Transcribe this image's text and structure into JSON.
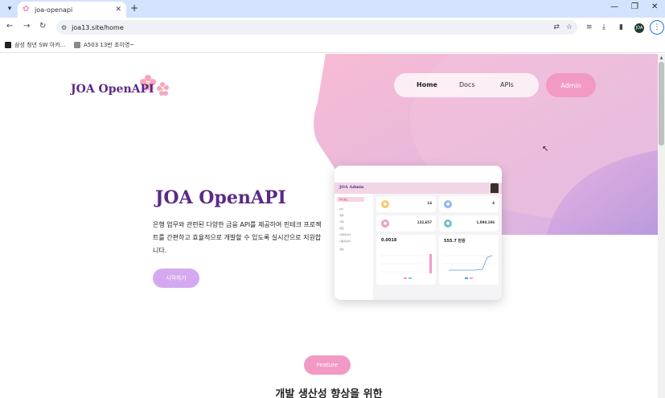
{
  "browser": {
    "tab_title": "joa-openapi",
    "tab_menu_icon": "chevron-down-icon",
    "new_tab": "+",
    "close_tab": "✕",
    "url": "joa13.site/home",
    "bookmarks": [
      "삼성 청년 SW 아카...",
      "A503 13반 조이영~"
    ],
    "profile_initials": "JOA"
  },
  "nav": {
    "logo_text": "JOA OpenAPI",
    "items": [
      {
        "label": "Home",
        "active": true
      },
      {
        "label": "Docs",
        "active": false
      },
      {
        "label": "APIs",
        "active": false
      }
    ],
    "admin_label": "Admin"
  },
  "hero": {
    "title": "JOA OpenAPI",
    "description": "은행 업무와 관련된 다양한 금융 API를 제공하여 핀테크 프로젝트를 간편하고 효율적으로 개발할 수 있도록 실시간으로 지원합니다.",
    "start_label": "시작하기"
  },
  "dashboard_preview": {
    "brand": "JOA Admin",
    "sidebar_items": [
      "대시보드",
      "API",
      "계좌",
      "거래",
      "회원",
      "더미데이터",
      "사용자관리",
      "설정"
    ],
    "cards": [
      {
        "value": "14",
        "icon_color": "#f7c873"
      },
      {
        "value": "4",
        "icon_color": "#8fb8f0"
      },
      {
        "value": "132,657",
        "icon_color": "#f59bc7"
      },
      {
        "value": "1,090,196",
        "icon_color": "#6fc4c9"
      }
    ],
    "chart_cards": [
      {
        "title": "0.0018",
        "tag": "...",
        "sub": "..."
      },
      {
        "title": "555.7 만원",
        "tag": "...",
        "sub": "..."
      }
    ]
  },
  "feature_label": "Feature",
  "section_title": "개발 생산성 향상을 위한",
  "colors": {
    "brand_purple": "#5b2a86",
    "pink": "#f29ac3",
    "lavender": "#d4a9f2"
  }
}
